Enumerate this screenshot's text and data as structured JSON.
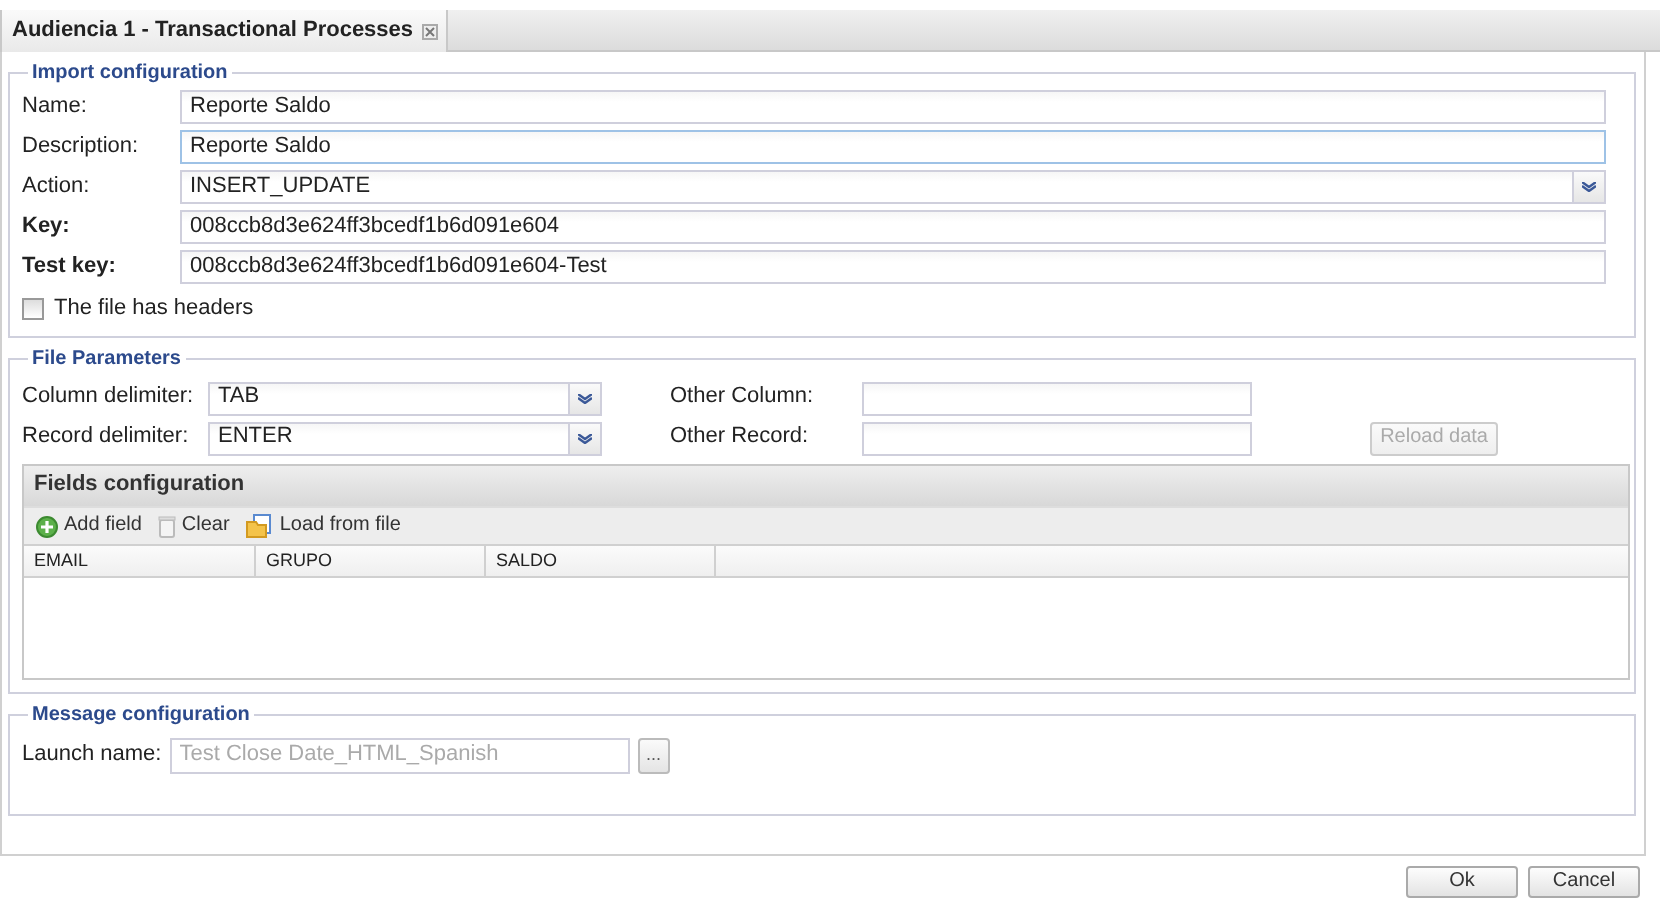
{
  "tab": {
    "title": "Audiencia 1 - Transactional Processes",
    "selected": true
  },
  "import_configuration": {
    "legend": "Import configuration",
    "fields": [
      {
        "label": "Name:",
        "value": "Reporte Saldo",
        "kind": "text",
        "bold": false,
        "focused": false
      },
      {
        "label": "Description:",
        "value": "Reporte Saldo",
        "kind": "text",
        "bold": false,
        "focused": true
      },
      {
        "label": "Action:",
        "value": "INSERT_UPDATE",
        "kind": "combo",
        "bold": false,
        "focused": false
      },
      {
        "label": "Key:",
        "value": "008ccb8d3e624ff3bcedf1b6d091e604",
        "kind": "text",
        "bold": true,
        "focused": false
      },
      {
        "label": "Test key:",
        "value": "008ccb8d3e624ff3bcedf1b6d091e604-Test",
        "kind": "text",
        "bold": true,
        "focused": false
      }
    ],
    "checkbox": {
      "label": "The file has headers",
      "checked": false
    }
  },
  "file_parameters": {
    "legend": "File Parameters",
    "rows": [
      {
        "label": "Column delimiter:",
        "value": "TAB",
        "other_label": "Other Column:"
      },
      {
        "label": "Record delimiter:",
        "value": "ENTER",
        "other_label": "Other Record:"
      }
    ],
    "reload_button": {
      "label": "Reload data",
      "disabled": true
    },
    "fields_configuration": {
      "title": "Fields configuration",
      "toolbar": [
        {
          "label": "Add field",
          "kind": "add"
        },
        {
          "label": "Clear",
          "kind": "clear"
        },
        {
          "label": "Load from file",
          "kind": "load"
        }
      ],
      "columns": [
        "EMAIL",
        "GRUPO",
        "SALDO"
      ]
    }
  },
  "message_configuration": {
    "legend": "Message configuration",
    "launch_name": {
      "label": "Launch name:",
      "value": "Test Close Date_HTML_Spanish",
      "disabled": true,
      "button": "..."
    }
  },
  "buttons": [
    {
      "label": "Ok"
    },
    {
      "label": "Cancel"
    }
  ]
}
